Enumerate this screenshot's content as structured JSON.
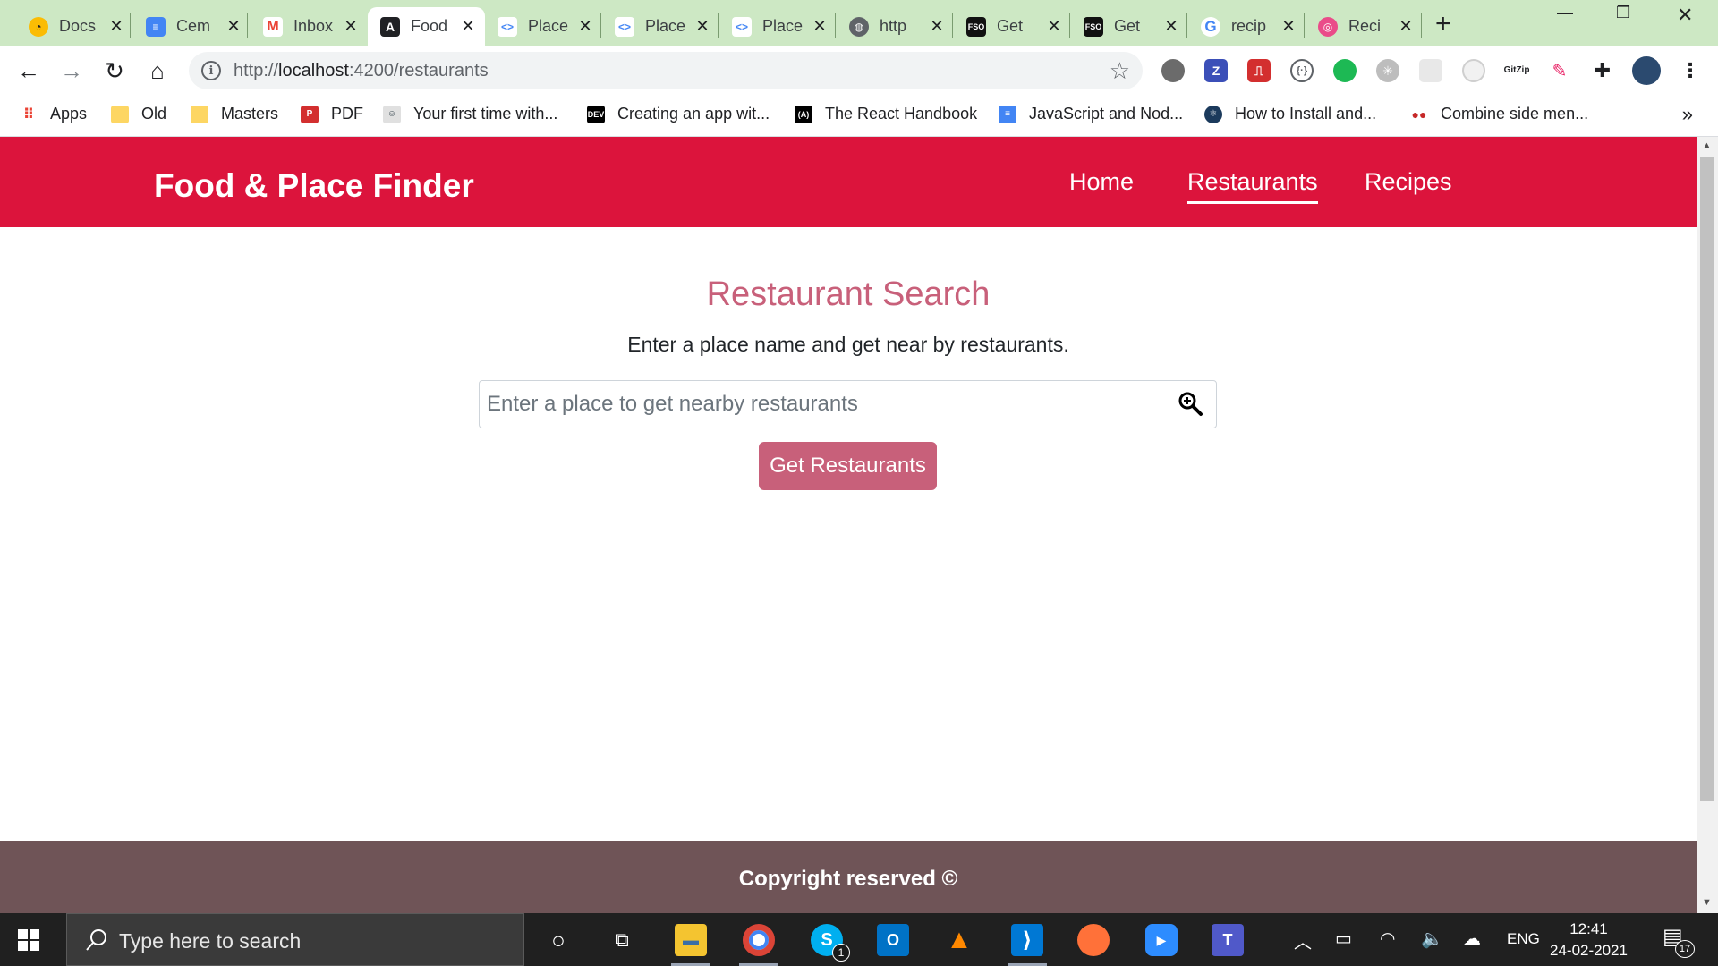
{
  "browser": {
    "tabs": [
      {
        "title": "Docs",
        "icon": "clock-face-icon",
        "color": "#fbbc04"
      },
      {
        "title": "Cem",
        "icon": "docs-icon",
        "color": "#4285f4"
      },
      {
        "title": "Inbox",
        "icon": "gmail-icon",
        "color": "#ea4335"
      },
      {
        "title": "Food",
        "icon": "angular-icon",
        "color": "#202124"
      },
      {
        "title": "Place",
        "icon": "code-tag-icon",
        "color": "#4285f4"
      },
      {
        "title": "Place",
        "icon": "code-tag-icon",
        "color": "#4285f4"
      },
      {
        "title": "Place",
        "icon": "code-tag-icon",
        "color": "#4285f4"
      },
      {
        "title": "http",
        "icon": "globe-icon",
        "color": "#5f6368"
      },
      {
        "title": "Get",
        "icon": "stackoverflow-fso-icon",
        "color": "#111111"
      },
      {
        "title": "Get",
        "icon": "stackoverflow-fso-icon",
        "color": "#111111"
      },
      {
        "title": "recip",
        "icon": "google-g-icon",
        "color": "#4285f4"
      },
      {
        "title": "Reci",
        "icon": "dribbble-icon",
        "color": "#ea4c89"
      }
    ],
    "address": {
      "scheme": "http://",
      "host": "localhost",
      "rest": ":4200/restaurants"
    },
    "bookmarks": [
      {
        "label": "Apps",
        "icon": "apps-grid-icon"
      },
      {
        "label": "Old",
        "icon": "folder-icon"
      },
      {
        "label": "Masters",
        "icon": "folder-icon"
      },
      {
        "label": "PDF",
        "icon": "pdf-icon"
      },
      {
        "label": "Your first time with...",
        "icon": "person-icon"
      },
      {
        "label": "Creating an app wit...",
        "icon": "dev-icon"
      },
      {
        "label": "The React Handbook",
        "icon": "react-handbook-icon"
      },
      {
        "label": "JavaScript and Nod...",
        "icon": "docs-icon"
      },
      {
        "label": "How to Install and...",
        "icon": "atom-icon"
      },
      {
        "label": "Combine side men...",
        "icon": "red-dots-icon"
      }
    ],
    "extensions": [
      "Z",
      "GitZip"
    ]
  },
  "app": {
    "brand": "Food & Place Finder",
    "nav": {
      "home": "Home",
      "restaurants": "Restaurants",
      "recipes": "Recipes"
    },
    "search": {
      "title": "Restaurant Search",
      "subtitle": "Enter a place name and get near by restaurants.",
      "placeholder": "Enter a place to get nearby restaurants",
      "button": "Get Restaurants"
    },
    "footer": "Copyright reserved ©",
    "colors": {
      "header": "#dc143c",
      "accent": "#c8607a",
      "footer": "#6f5457"
    }
  },
  "taskbar": {
    "search_placeholder": "Type here to search",
    "skype_badge": "1",
    "language": "ENG",
    "time": "12:41",
    "date": "24-02-2021",
    "notification_count": "17"
  }
}
